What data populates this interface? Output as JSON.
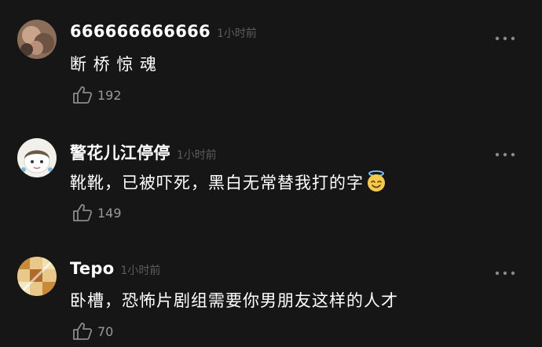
{
  "comments": [
    {
      "username": "666666666666",
      "time": "1小时前",
      "text": "断 桥 惊 魂",
      "likes": "192",
      "avatar_icon": "avatar-photo-icon"
    },
    {
      "username": "警花儿江停停",
      "time": "1小时前",
      "text": "靴靴，已被吓死，黑白无常替我打的字",
      "emoji": "smiling-face-with-halo-icon",
      "likes": "149",
      "avatar_icon": "avatar-cartoon-icon"
    },
    {
      "username": "Tepo",
      "time": "1小时前",
      "text": "卧槽，恐怖片剧组需要你男朋友这样的人才",
      "likes": "70",
      "avatar_icon": "avatar-pattern-icon"
    }
  ],
  "icons": {
    "like": "thumbs-up-icon",
    "more": "more-options-icon"
  },
  "colors": {
    "background": "#161616",
    "username": "#ffffff",
    "text": "#ffffff",
    "time": "#5c5c5c",
    "count": "#9a9a9a",
    "icon": "#8a8a8a"
  }
}
